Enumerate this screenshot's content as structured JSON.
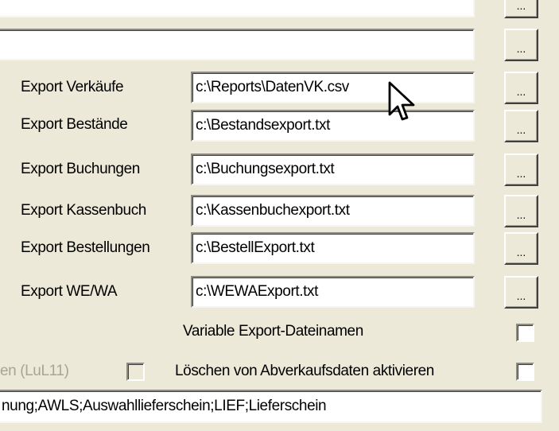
{
  "browse_label": "...",
  "rows": [
    {
      "label": "",
      "value": ""
    },
    {
      "label": "",
      "value": ""
    },
    {
      "label": "Export Verkäufe",
      "value": "c:\\Reports\\DatenVK.csv"
    },
    {
      "label": "Export Bestände",
      "value": "c:\\Bestandsexport.txt"
    },
    {
      "label": "Export Buchungen",
      "value": "c:\\Buchungsexport.txt"
    },
    {
      "label": "Export Kassenbuch",
      "value": "c:\\Kassenbuchexport.txt"
    },
    {
      "label": "Export Bestellungen",
      "value": "c:\\BestellExport.txt"
    },
    {
      "label": "Export WE/WA",
      "value": "c:\\WEWAExport.txt"
    }
  ],
  "options": {
    "variable_names": {
      "label": "Variable Export-Dateinamen",
      "checked": false
    },
    "lul11": {
      "label": "en (LuL11)",
      "checked": false,
      "enabled": false
    },
    "delete_sales": {
      "label": "Löschen von Abverkaufsdaten aktivieren",
      "checked": false
    }
  },
  "bottom_field": {
    "value": "nung;AWLS;Auswahllieferschein;LIEF;Lieferschein"
  }
}
